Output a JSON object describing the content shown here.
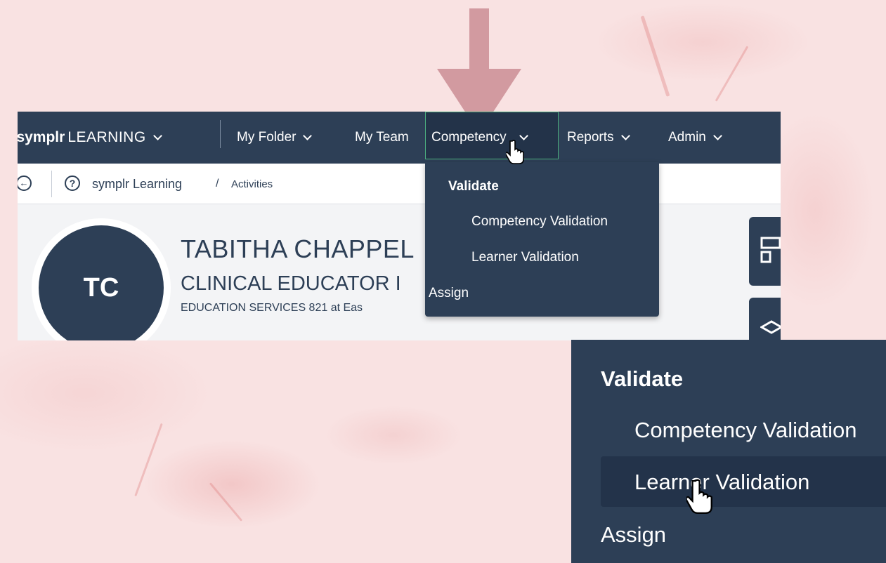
{
  "navbar": {
    "brand_name": "symplr",
    "brand_product": "LEARNING",
    "items": [
      {
        "label": "My Folder"
      },
      {
        "label": "My Team"
      },
      {
        "label": "Competency"
      },
      {
        "label": "Reports"
      },
      {
        "label": "Admin"
      }
    ]
  },
  "breadcrumb": {
    "root": "symplr Learning",
    "separator": "/",
    "current": "Activities"
  },
  "profile": {
    "initials": "TC",
    "name": "TABITHA CHAPPEL",
    "title": "CLINICAL EDUCATOR I",
    "department": "EDUCATION SERVICES 821 at Eas"
  },
  "competency_menu": {
    "section_validate": "Validate",
    "items": [
      "Competency Validation",
      "Learner Validation"
    ],
    "section_assign": "Assign"
  },
  "colors": {
    "navbar": "#2d3f56",
    "arrow": "#d29aa0",
    "active_outline": "#4caf7f",
    "background": "#f9e2e2"
  },
  "icons": [
    "back-circle-icon",
    "help-circle-icon",
    "grid-icon",
    "graduation-cap-icon",
    "chevron-down-icon",
    "hand-pointer-icon",
    "down-arrow-icon"
  ]
}
